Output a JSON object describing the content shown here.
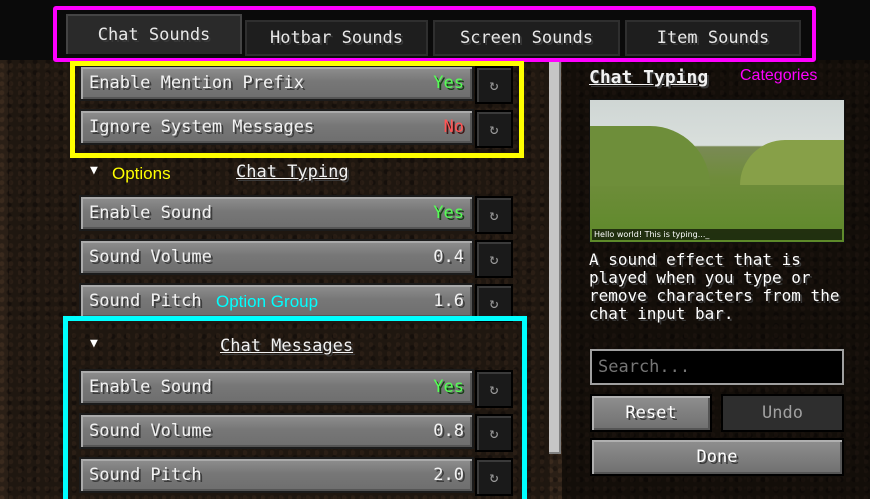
{
  "tabs": [
    {
      "label": "Chat Sounds",
      "active": true
    },
    {
      "label": "Hotbar Sounds",
      "active": false
    },
    {
      "label": "Screen Sounds",
      "active": false
    },
    {
      "label": "Item Sounds",
      "active": false
    }
  ],
  "general": {
    "mention_prefix": {
      "label": "Enable Mention Prefix",
      "value": "Yes"
    },
    "ignore_system": {
      "label": "Ignore System Messages",
      "value": "No"
    }
  },
  "chat_typing": {
    "heading": "Chat Typing",
    "enable_sound": {
      "label": "Enable Sound",
      "value": "Yes"
    },
    "sound_volume": {
      "label": "Sound Volume",
      "value": "0.4"
    },
    "sound_pitch": {
      "label": "Sound Pitch",
      "value": "1.6"
    }
  },
  "chat_messages": {
    "heading": "Chat Messages",
    "enable_sound": {
      "label": "Enable Sound",
      "value": "Yes"
    },
    "sound_volume": {
      "label": "Sound Volume",
      "value": "0.8"
    },
    "sound_pitch": {
      "label": "Sound Pitch",
      "value": "2.0"
    }
  },
  "reset_icon": "↻",
  "caret_icon": "▼",
  "annotations": {
    "options": "Options",
    "option_group": "Option Group",
    "categories": "Categories",
    "colors": {
      "tabs": "#ff00ff",
      "options": "#ffff00",
      "group": "#00ffff"
    }
  },
  "info": {
    "title": "Chat Typing",
    "preview_chat": "Hello world! This is typing..._",
    "description": "A sound effect that is played when you type or remove characters from the chat input bar."
  },
  "search": {
    "placeholder": "Search..."
  },
  "buttons": {
    "reset": "Reset",
    "undo": "Undo",
    "done": "Done"
  }
}
